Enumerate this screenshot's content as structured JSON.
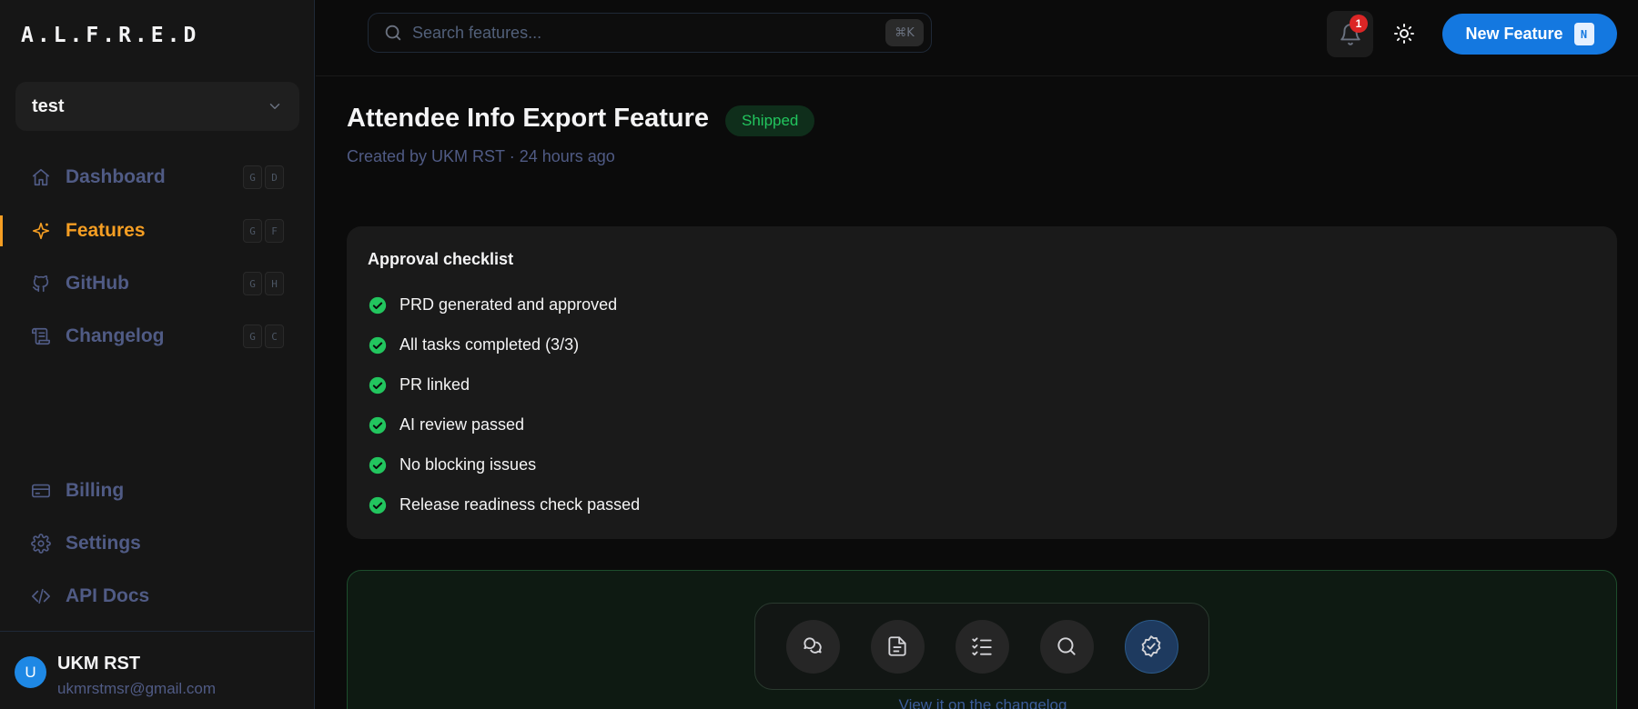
{
  "app": {
    "logo": "A.L.F.R.E.D"
  },
  "project": {
    "name": "test"
  },
  "sidebar": {
    "nav": [
      {
        "label": "Dashboard",
        "keys": [
          "G",
          "D"
        ],
        "icon": "home-icon"
      },
      {
        "label": "Features",
        "keys": [
          "G",
          "F"
        ],
        "icon": "sparkle-icon",
        "active": true
      },
      {
        "label": "GitHub",
        "keys": [
          "G",
          "H"
        ],
        "icon": "github-icon"
      },
      {
        "label": "Changelog",
        "keys": [
          "G",
          "C"
        ],
        "icon": "scroll-icon"
      }
    ],
    "bottom": [
      {
        "label": "Billing",
        "icon": "card-icon"
      },
      {
        "label": "Settings",
        "icon": "gear-icon"
      },
      {
        "label": "API Docs",
        "icon": "code-icon"
      }
    ],
    "user": {
      "initial": "U",
      "name": "UKM RST",
      "email": "ukmrstmsr@gmail.com"
    }
  },
  "topbar": {
    "search_placeholder": "Search features...",
    "search_shortcut": "⌘K",
    "notifications_count": "1",
    "new_feature_label": "New Feature",
    "new_feature_key": "N"
  },
  "feature": {
    "title": "Attendee Info Export Feature",
    "status": "Shipped",
    "meta": "Created by UKM RST · 24 hours ago"
  },
  "checklist": {
    "title": "Approval checklist",
    "items": [
      "PRD generated and approved",
      "All tasks completed (3/3)",
      "PR linked",
      "AI review passed",
      "No blocking issues",
      "Release readiness check passed"
    ]
  },
  "workflow": {
    "steps": [
      "chat-icon",
      "document-icon",
      "tasks-icon",
      "review-search-icon",
      "verified-badge-icon"
    ],
    "active_step": 4,
    "link_text": "View it on the changelog"
  },
  "colors": {
    "accent": "#f59e23",
    "primary": "#1478e0",
    "success": "#22c55e",
    "muted": "#505b85"
  }
}
